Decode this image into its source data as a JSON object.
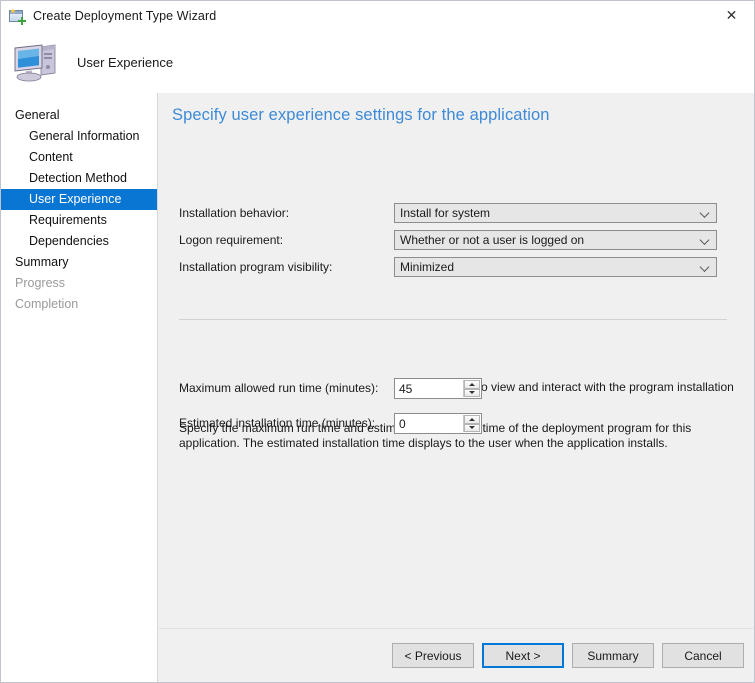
{
  "window": {
    "title": "Create Deployment Type Wizard",
    "title_icon": "wizard-icon",
    "close_label": "✕",
    "header_title": "User Experience",
    "header_icon": "computer-icon"
  },
  "sidebar": {
    "items": [
      {
        "label": "General",
        "indent": false,
        "state": "normal"
      },
      {
        "label": "General Information",
        "indent": true,
        "state": "normal"
      },
      {
        "label": "Content",
        "indent": true,
        "state": "normal"
      },
      {
        "label": "Detection Method",
        "indent": true,
        "state": "normal"
      },
      {
        "label": "User Experience",
        "indent": true,
        "state": "selected"
      },
      {
        "label": "Requirements",
        "indent": true,
        "state": "normal"
      },
      {
        "label": "Dependencies",
        "indent": true,
        "state": "normal"
      },
      {
        "label": "Summary",
        "indent": false,
        "state": "normal"
      },
      {
        "label": "Progress",
        "indent": false,
        "state": "disabled"
      },
      {
        "label": "Completion",
        "indent": false,
        "state": "disabled"
      }
    ]
  },
  "main": {
    "heading": "Specify user experience settings for the application",
    "fields": {
      "installation_behavior": {
        "label": "Installation behavior:",
        "value": "Install for system"
      },
      "logon_requirement": {
        "label": "Logon requirement:",
        "value": "Whether or not a user is logged on"
      },
      "program_visibility": {
        "label": "Installation program visibility:",
        "value": "Minimized"
      }
    },
    "allow_interact": {
      "label": "Allow users to view and interact with the program installation",
      "checked": false
    },
    "description": "Specify the maximum run time and estimated installation time of the deployment program for this application. The estimated installation time displays to the user when the application installs.",
    "max_run_time": {
      "label": "Maximum allowed run time (minutes):",
      "value": "45"
    },
    "estimated_install_time": {
      "label": "Estimated installation time (minutes):",
      "value": "0"
    }
  },
  "footer": {
    "previous_label": "< Previous",
    "next_label": "Next >",
    "summary_label": "Summary",
    "cancel_label": "Cancel"
  },
  "colors": {
    "accent": "#0a76d4",
    "heading": "#3d8ad8",
    "focus": "#0078d7",
    "dialog_bg": "#f0f0f0"
  }
}
